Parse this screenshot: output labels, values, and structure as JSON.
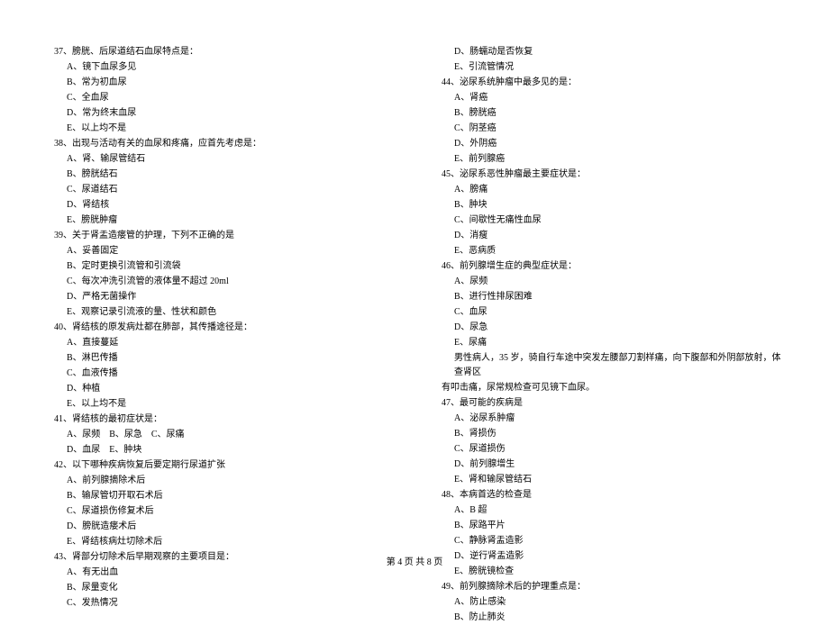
{
  "left_column": {
    "q37": {
      "title": "37、膀胱、后尿道结石血尿特点是：",
      "options": {
        "A": "A、镜下血尿多见",
        "B": "B、常为初血尿",
        "C": "C、全血尿",
        "D": "D、常为终末血尿",
        "E": "E、以上均不是"
      }
    },
    "q38": {
      "title": "38、出现与活动有关的血尿和疼痛，应首先考虑是：",
      "options": {
        "A": "A、肾、输尿管结石",
        "B": "B、膀胱结石",
        "C": "C、尿道结石",
        "D": "D、肾结核",
        "E": "E、膀胱肿瘤"
      }
    },
    "q39": {
      "title": "39、关于肾盂造瘘管的护理，下列不正确的是",
      "options": {
        "A": "A、妥善固定",
        "B": "B、定时更换引流管和引流袋",
        "C": "C、每次冲洗引流管的液体量不超过 20ml",
        "D": "D、严格无菌操作",
        "E": "E、观察记录引流液的量、性状和颜色"
      }
    },
    "q40": {
      "title": "40、肾结核的原发病灶都在肺部，其传播途径是：",
      "options": {
        "A": "A、直接蔓延",
        "B": "B、淋巴传播",
        "C": "C、血液传播",
        "D": "D、种植",
        "E": "E、以上均不是"
      }
    },
    "q41": {
      "title": "41、肾结核的最初症状是：",
      "options": {
        "A": "A、尿频　B、尿急　C、尿痛",
        "D": "D、血尿　E、肿块"
      }
    },
    "q42": {
      "title": "42、以下哪种疾病恢复后要定期行尿道扩张",
      "options": {
        "A": "A、前列腺摘除术后",
        "B": "B、输尿管切开取石术后",
        "C": "C、尿道损伤修复术后",
        "D": "D、膀胱造瘘术后",
        "E": "E、肾结核病灶切除术后"
      }
    },
    "q43": {
      "title": "43、肾部分切除术后早期观察的主要项目是：",
      "options": {
        "A": "A、有无出血",
        "B": "B、尿量变化",
        "C": "C、发热情况"
      }
    }
  },
  "right_column": {
    "q43_cont": {
      "options": {
        "D": "D、肠蠕动是否恢复",
        "E": "E、引流管情况"
      }
    },
    "q44": {
      "title": "44、泌尿系统肿瘤中最多见的是：",
      "options": {
        "A": "A、肾癌",
        "B": "B、膀胱癌",
        "C": "C、阴茎癌",
        "D": "D、外阴癌",
        "E": "E、前列腺癌"
      }
    },
    "q45": {
      "title": "45、泌尿系恶性肿瘤最主要症状是：",
      "options": {
        "A": "A、膀痛",
        "B": "B、肿块",
        "C": "C、间歇性无痛性血尿",
        "D": "D、消瘦",
        "E": "E、恶病质"
      }
    },
    "q46": {
      "title": "46、前列腺增生症的典型症状是：",
      "options": {
        "A": "A、尿频",
        "B": "B、进行性排尿困难",
        "C": "C、血尿",
        "D": "D、尿急",
        "E": "E、尿痛"
      }
    },
    "case_intro": "男性病人，35 岁，骑自行车途中突发左腰部刀割样痛，向下腹部和外阴部放射，体查肾区",
    "case_intro2": "有叩击痛，尿常规检查可见镜下血尿。",
    "q47": {
      "title": "47、最可能的疾病是",
      "options": {
        "A": "A、泌尿系肿瘤",
        "B": "B、肾损伤",
        "C": "C、尿道损伤",
        "D": "D、前列腺增生",
        "E": "E、肾和输尿管结石"
      }
    },
    "q48": {
      "title": "48、本病首选的检查是",
      "options": {
        "A": "A、B 超",
        "B": "B、尿路平片",
        "C": "C、静脉肾盂造影",
        "D": "D、逆行肾盂造影",
        "E": "E、膀胱镜检查"
      }
    },
    "q49": {
      "title": "49、前列腺摘除术后的护理重点是：",
      "options": {
        "A": "A、防止感染",
        "B": "B、防止肺炎"
      }
    }
  },
  "footer": "第 4 页 共 8 页"
}
